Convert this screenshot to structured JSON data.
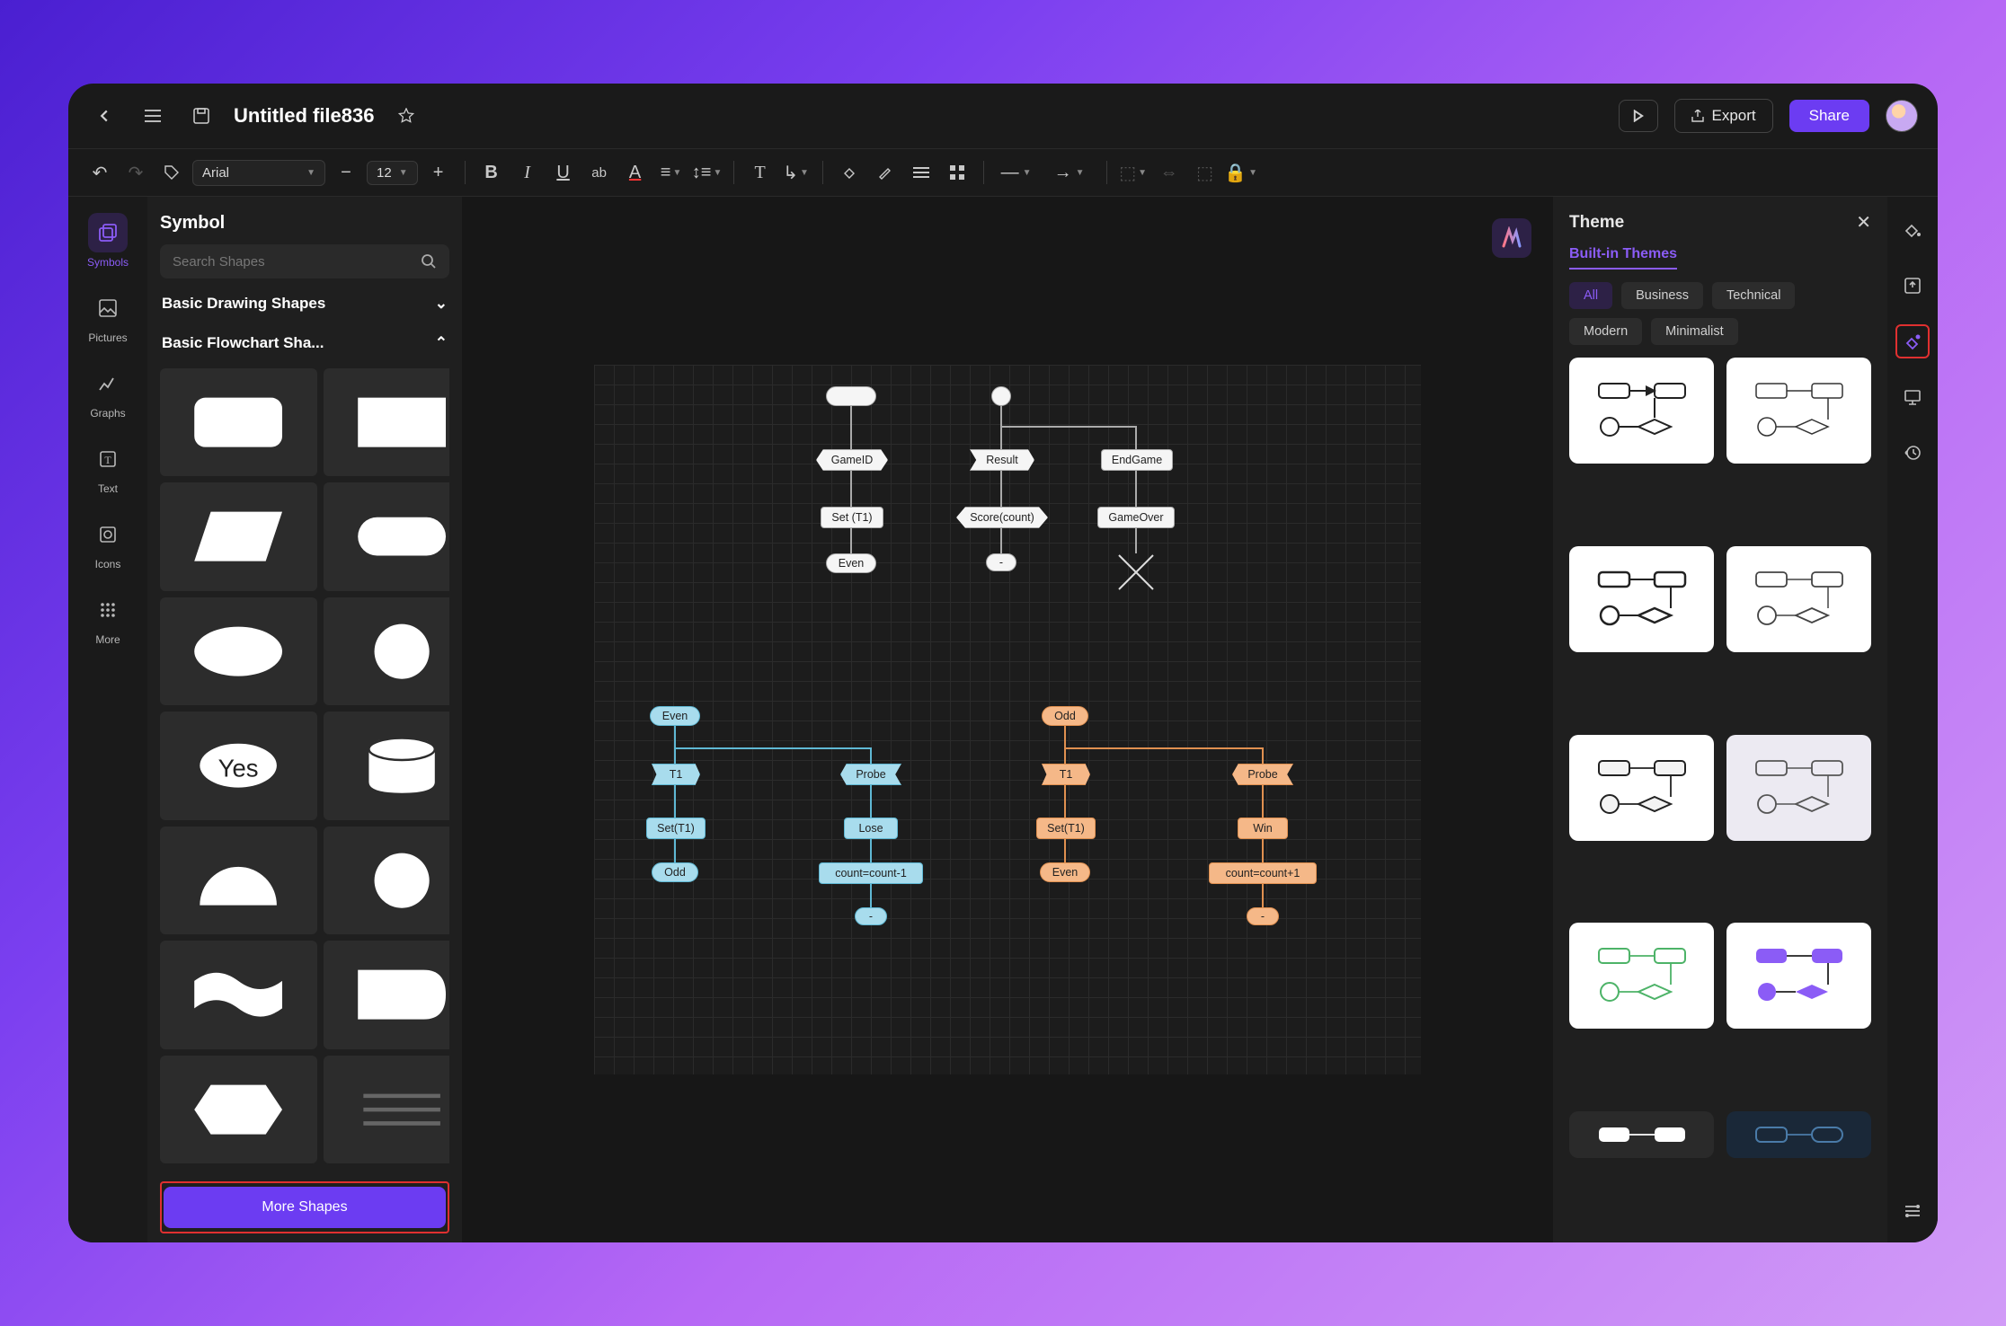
{
  "titlebar": {
    "filename": "Untitled file836",
    "export_label": "Export",
    "share_label": "Share"
  },
  "toolbar": {
    "font": "Arial",
    "font_size": "12"
  },
  "left_rail": {
    "items": [
      {
        "label": "Symbols",
        "active": true
      },
      {
        "label": "Pictures"
      },
      {
        "label": "Graphs"
      },
      {
        "label": "Text"
      },
      {
        "label": "Icons"
      },
      {
        "label": "More"
      }
    ]
  },
  "symbol_panel": {
    "title": "Symbol",
    "search_placeholder": "Search Shapes",
    "cat1_label": "Basic Drawing Shapes",
    "cat2_label": "Basic Flowchart Sha...",
    "more_shapes_label": "More Shapes",
    "yes_label": "Yes"
  },
  "canvas": {
    "white": {
      "game_id": "GameID",
      "set_t1": "Set (T1)",
      "even": "Even",
      "result": "Result",
      "score_count": "Score(count)",
      "dash": "-",
      "endgame": "EndGame",
      "gameover": "GameOver"
    },
    "blue": {
      "even": "Even",
      "t1": "T1",
      "set_t1": "Set(T1)",
      "odd": "Odd",
      "probe": "Probe",
      "lose": "Lose",
      "count_dec": "count=count-1",
      "dash": "-"
    },
    "orange": {
      "odd": "Odd",
      "t1": "T1",
      "set_t1": "Set(T1)",
      "even": "Even",
      "probe": "Probe",
      "win": "Win",
      "count_inc": "count=count+1",
      "dash": "-"
    }
  },
  "theme_panel": {
    "title": "Theme",
    "tab_label": "Built-in Themes",
    "filters": {
      "all": "All",
      "business": "Business",
      "technical": "Technical",
      "modern": "Modern",
      "minimalist": "Minimalist"
    }
  }
}
